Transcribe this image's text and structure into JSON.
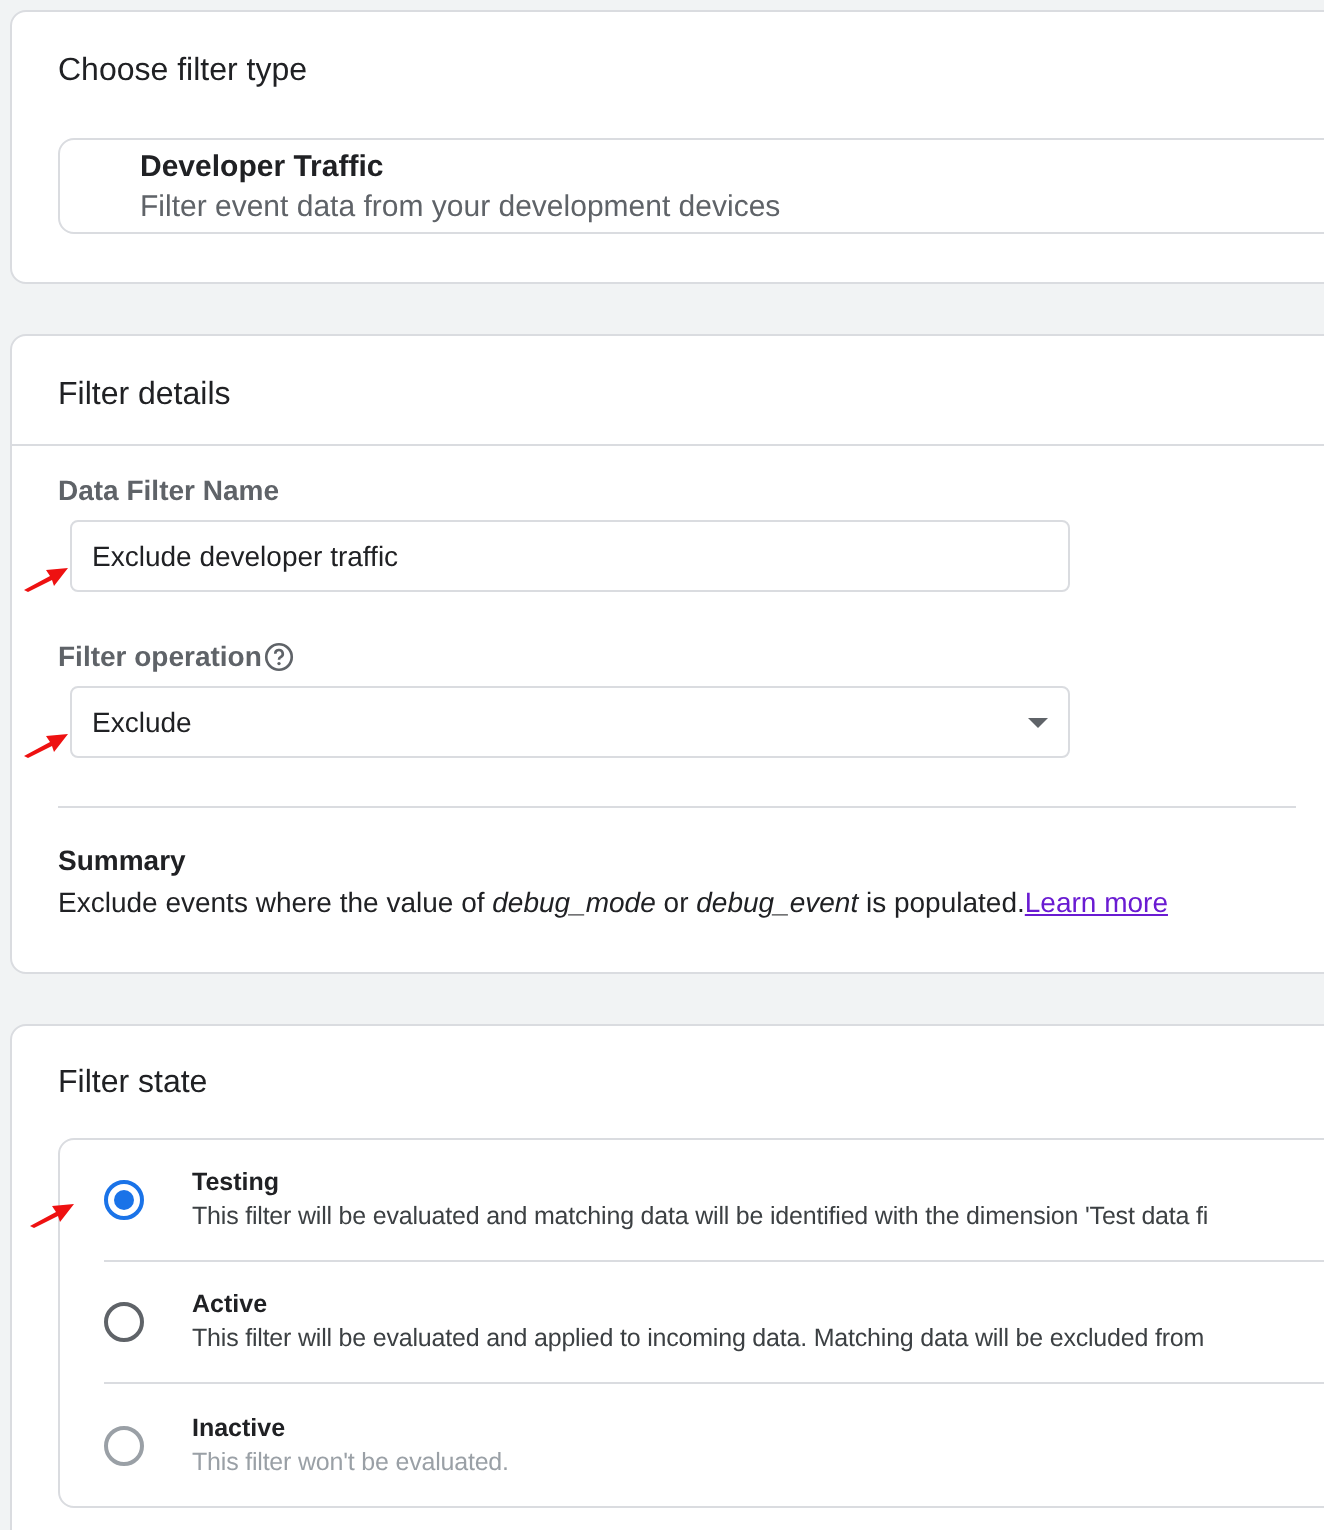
{
  "filter_type": {
    "title": "Choose filter type",
    "option": {
      "name": "Developer Traffic",
      "description": "Filter event data from your development devices"
    }
  },
  "filter_details": {
    "title": "Filter details",
    "name_field": {
      "label": "Data Filter Name",
      "value": "Exclude developer traffic"
    },
    "operation_field": {
      "label": "Filter operation",
      "value": "Exclude"
    },
    "summary": {
      "title": "Summary",
      "text": "Exclude events where the value of *debug_mode* or *debug_event* is populated.",
      "link": "Learn more"
    }
  },
  "filter_state": {
    "title": "Filter state",
    "options": [
      {
        "label": "Testing",
        "description": "This filter will be evaluated and matching data will be identified with the dimension 'Test data fi",
        "selected": true,
        "disabled": false
      },
      {
        "label": "Active",
        "description": "This filter will be evaluated and applied to incoming data. Matching data will be excluded from",
        "selected": false,
        "disabled": false
      },
      {
        "label": "Inactive",
        "description": "This filter won't be evaluated.",
        "selected": false,
        "disabled": true
      }
    ]
  }
}
